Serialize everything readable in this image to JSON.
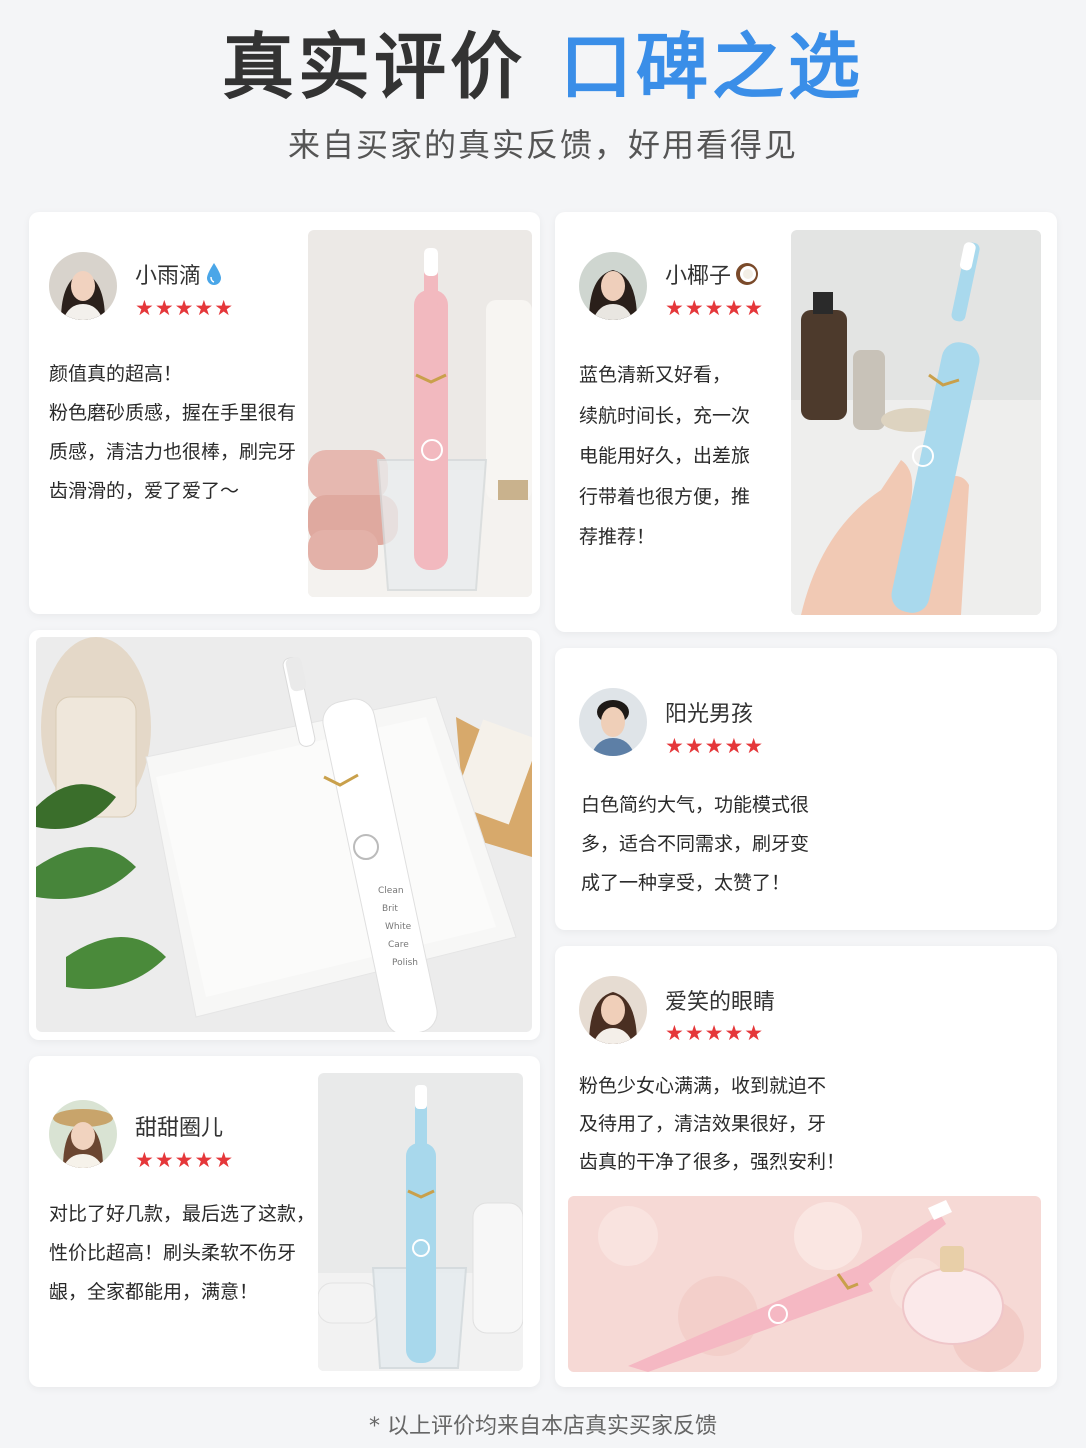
{
  "header": {
    "title_part1": "真实评价",
    "title_part2": "口碑之选",
    "subtitle": "来自买家的真实反馈，好用看得见"
  },
  "colors": {
    "accent": "#3a8ee8",
    "star": "#e5373a",
    "background": "#f4f5f7"
  },
  "reviews": [
    {
      "name": "小雨滴",
      "name_icon": "water-drop-icon",
      "stars": "★★★★★",
      "rating": 5,
      "lines": [
        "颜值真的超高！",
        "粉色磨砂质感，握在手里很有",
        "质感，清洁力也很棒，刷完牙",
        "齿滑滑的，爱了爱了～"
      ],
      "photo": "pink-toothbrush-in-glass"
    },
    {
      "name": "小椰子",
      "name_icon": "coconut-icon",
      "stars": "★★★★★",
      "rating": 5,
      "lines": [
        "蓝色清新又好看，",
        "续航时间长，充一次",
        "电能用好久，出差旅",
        "行带着也很方便，推",
        "荐推荐！"
      ],
      "photo": "hand-holding-blue-toothbrush"
    },
    {
      "name": "阳光男孩",
      "stars": "★★★★★",
      "rating": 5,
      "lines": [
        "白色简约大气，功能模式很",
        "多，适合不同需求，刷牙变",
        "成了一种享受，太赞了！"
      ]
    },
    {
      "name": "爱笑的眼睛",
      "stars": "★★★★★",
      "rating": 5,
      "lines": [
        "粉色少女心满满，收到就迫不",
        "及待用了，清洁效果很好，牙",
        "齿真的干净了很多，强烈安利！"
      ],
      "photo": "pink-toothbrush-on-fluffy-rug"
    },
    {
      "name": "甜甜圈儿",
      "stars": "★★★★★",
      "rating": 5,
      "lines": [
        "对比了好几款，最后选了这款，",
        "性价比超高！刷头柔软不伤牙",
        "龈，全家都能用，满意！"
      ],
      "photo": "blue-toothbrush-in-glass"
    }
  ],
  "middle_photo": "white-toothbrush-on-towel",
  "brush_labels": [
    "Clean",
    "Brit",
    "White",
    "Care",
    "Polish"
  ],
  "footnote": "* 以上评价均来自本店真实买家反馈"
}
